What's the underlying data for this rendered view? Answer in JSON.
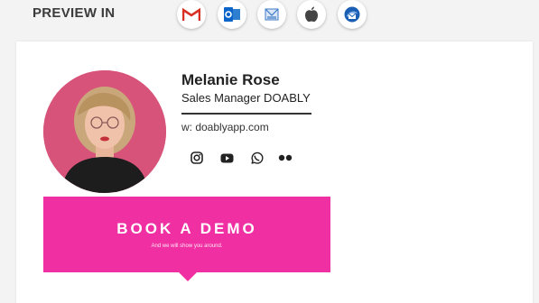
{
  "preview": {
    "label": "PREVIEW IN",
    "clients": [
      {
        "icon": "gmail-icon"
      },
      {
        "icon": "outlook-icon"
      },
      {
        "icon": "apple-mail-icon"
      },
      {
        "icon": "apple-icon"
      },
      {
        "icon": "thunderbird-icon"
      }
    ]
  },
  "signature": {
    "name": "Melanie Rose",
    "title": "Sales Manager DOABLY",
    "website": "w: doablyapp.com",
    "social_icons": [
      "instagram-icon",
      "youtube-icon",
      "whatsapp-icon",
      "flickr-icon"
    ],
    "cta": {
      "title": "BOOK A DEMO",
      "subtitle": "And we will show you around."
    }
  },
  "colors": {
    "accent": "#f02fa3",
    "avatar_bg": "#d8537a"
  }
}
